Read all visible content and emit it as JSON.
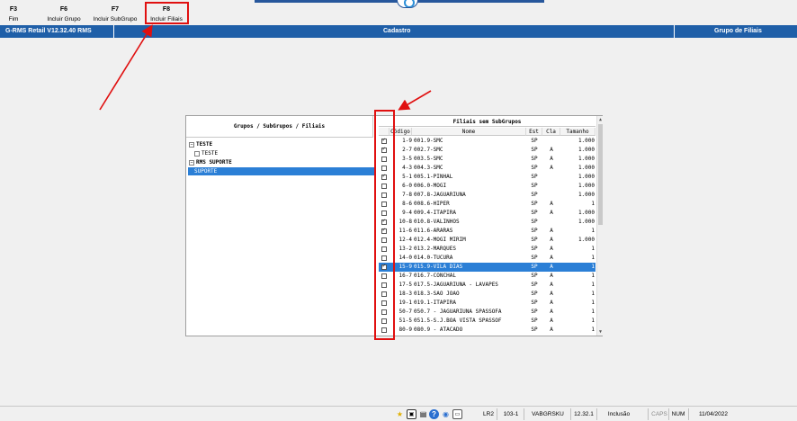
{
  "toolbar": {
    "keys": [
      {
        "key": "F3",
        "label": "Fim"
      },
      {
        "key": "F6",
        "label": "Incluir Grupo"
      },
      {
        "key": "F7",
        "label": "Incluir SubGrupo"
      },
      {
        "key": "F8",
        "label": "Incluir Filiais"
      }
    ]
  },
  "header": {
    "app": "G-RMS Retail V12.32.40 RMS",
    "center": "Cadastro",
    "right": "Grupo de Filiais"
  },
  "tree": {
    "title": "Grupos / SubGrupos / Filiais",
    "nodes": [
      {
        "label": "TESTE",
        "level": 0,
        "expander": "−",
        "selected": false
      },
      {
        "label": "TESTE",
        "level": 1,
        "expander": "",
        "selected": false
      },
      {
        "label": "RMS SUPORTE",
        "level": 0,
        "expander": "−",
        "selected": false
      },
      {
        "label": "SUPORTE",
        "level": 1,
        "expander": "",
        "selected": true
      }
    ]
  },
  "grid": {
    "title": "Filiais sem SubGrupos",
    "columns": [
      "Código",
      "Nome",
      "Est",
      "Cla",
      "Tamanho"
    ],
    "rows": [
      {
        "checked": true,
        "codigo": "1-9",
        "nome": "001.9-SMC",
        "est": "SP",
        "cla": "",
        "tamanho": "1.000",
        "selected": false
      },
      {
        "checked": true,
        "codigo": "2-7",
        "nome": "002.7-SMC",
        "est": "SP",
        "cla": "A",
        "tamanho": "1.000",
        "selected": false
      },
      {
        "checked": false,
        "codigo": "3-5",
        "nome": "003.5-SMC",
        "est": "SP",
        "cla": "A",
        "tamanho": "1.000",
        "selected": false
      },
      {
        "checked": false,
        "codigo": "4-3",
        "nome": "004.3-SMC",
        "est": "SP",
        "cla": "A",
        "tamanho": "1.000",
        "selected": false
      },
      {
        "checked": true,
        "codigo": "5-1",
        "nome": "005.1-PINHAL",
        "est": "SP",
        "cla": "",
        "tamanho": "1.000",
        "selected": false
      },
      {
        "checked": false,
        "codigo": "6-0",
        "nome": "006.0-MOGI",
        "est": "SP",
        "cla": "",
        "tamanho": "1.000",
        "selected": false
      },
      {
        "checked": false,
        "codigo": "7-8",
        "nome": "007.8-JAGUARIUNA",
        "est": "SP",
        "cla": "",
        "tamanho": "1.000",
        "selected": false
      },
      {
        "checked": false,
        "codigo": "8-6",
        "nome": "008.6-HIPER",
        "est": "SP",
        "cla": "A",
        "tamanho": "1",
        "selected": false
      },
      {
        "checked": false,
        "codigo": "9-4",
        "nome": "009.4-ITAPIRA",
        "est": "SP",
        "cla": "A",
        "tamanho": "1.000",
        "selected": false
      },
      {
        "checked": true,
        "codigo": "10-8",
        "nome": "010.8-VALINHOS",
        "est": "SP",
        "cla": "",
        "tamanho": "1.000",
        "selected": false
      },
      {
        "checked": true,
        "codigo": "11-6",
        "nome": "011.6-ARARAS",
        "est": "SP",
        "cla": "A",
        "tamanho": "1",
        "selected": false
      },
      {
        "checked": false,
        "codigo": "12-4",
        "nome": "012.4-MOGI MIRIM",
        "est": "SP",
        "cla": "A",
        "tamanho": "1.000",
        "selected": false
      },
      {
        "checked": false,
        "codigo": "13-2",
        "nome": "013.2-MARQUES",
        "est": "SP",
        "cla": "A",
        "tamanho": "1",
        "selected": false
      },
      {
        "checked": false,
        "codigo": "14-0",
        "nome": "014.0-TUCURA",
        "est": "SP",
        "cla": "A",
        "tamanho": "1",
        "selected": false
      },
      {
        "checked": true,
        "codigo": "15-9",
        "nome": "015.9-VILA DIAS",
        "est": "SP",
        "cla": "A",
        "tamanho": "1",
        "selected": true
      },
      {
        "checked": false,
        "codigo": "16-7",
        "nome": "016.7-CONCHAL",
        "est": "SP",
        "cla": "A",
        "tamanho": "1",
        "selected": false
      },
      {
        "checked": false,
        "codigo": "17-5",
        "nome": "017.5-JAGUARIUNA - LAVAPES",
        "est": "SP",
        "cla": "A",
        "tamanho": "1",
        "selected": false
      },
      {
        "checked": false,
        "codigo": "18-3",
        "nome": "018.3-SAO JOAO",
        "est": "SP",
        "cla": "A",
        "tamanho": "1",
        "selected": false
      },
      {
        "checked": false,
        "codigo": "19-1",
        "nome": "019.1-ITAPIRA",
        "est": "SP",
        "cla": "A",
        "tamanho": "1",
        "selected": false
      },
      {
        "checked": false,
        "codigo": "50-7",
        "nome": "050.7 - JAGUARIUNA SPASSOFA",
        "est": "SP",
        "cla": "A",
        "tamanho": "1",
        "selected": false
      },
      {
        "checked": false,
        "codigo": "51-5",
        "nome": "051.5-S.J.BOA VISTA SPASSOF",
        "est": "SP",
        "cla": "A",
        "tamanho": "1",
        "selected": false
      },
      {
        "checked": false,
        "codigo": "80-9",
        "nome": "080.9 - ATACADO",
        "est": "SP",
        "cla": "A",
        "tamanho": "1",
        "selected": false
      }
    ]
  },
  "status": {
    "icons": [
      "star-icon",
      "network-icon",
      "help-icon",
      "chat-icon",
      "clipboard-icon"
    ],
    "fields": [
      "LR2",
      "103-1",
      "VABGRSKU",
      "12.32.1",
      "Inclusão",
      "CAPS",
      "NUM",
      "11/04/2022"
    ]
  },
  "colors": {
    "header": "#1f5fa8",
    "selection": "#2b7fd6",
    "annotation": "#e01010"
  }
}
